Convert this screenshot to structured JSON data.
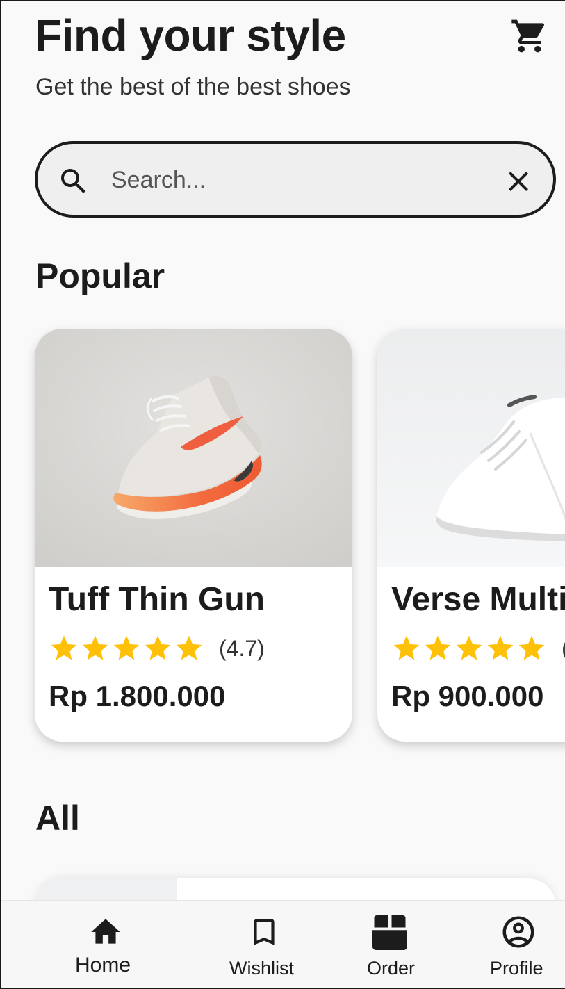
{
  "header": {
    "title": "Find your style",
    "subtitle": "Get the best of the best shoes",
    "cart_icon": "shopping-cart-icon"
  },
  "search": {
    "placeholder": "Search...",
    "value": "",
    "search_icon": "search-icon",
    "clear_icon": "close-icon"
  },
  "sections": {
    "popular_title": "Popular",
    "all_title": "All"
  },
  "popular": [
    {
      "name": "Tuff Thin Gun",
      "rating": 4.7,
      "rating_text": "(4.7)",
      "stars_filled": 5,
      "price": "Rp 1.800.000",
      "image": "orange-white-sneaker-photo"
    },
    {
      "name": "Verse Multi",
      "rating_text": "(",
      "stars_filled": 5,
      "price": "Rp 900.000",
      "image": "white-sneaker-photo"
    }
  ],
  "nav": {
    "items": [
      {
        "label": "Home",
        "icon": "home-icon",
        "active": true
      },
      {
        "label": "Wishlist",
        "icon": "bookmark-icon",
        "active": false
      },
      {
        "label": "Order",
        "icon": "box-icon",
        "active": false
      },
      {
        "label": "Profile",
        "icon": "account-circle-icon",
        "active": false
      }
    ]
  },
  "colors": {
    "star": "#FFC107",
    "text": "#1C1C1C",
    "background": "#F9F9F9",
    "search_bg": "#EFEFEF",
    "sneaker_accent": "#F2603A"
  }
}
